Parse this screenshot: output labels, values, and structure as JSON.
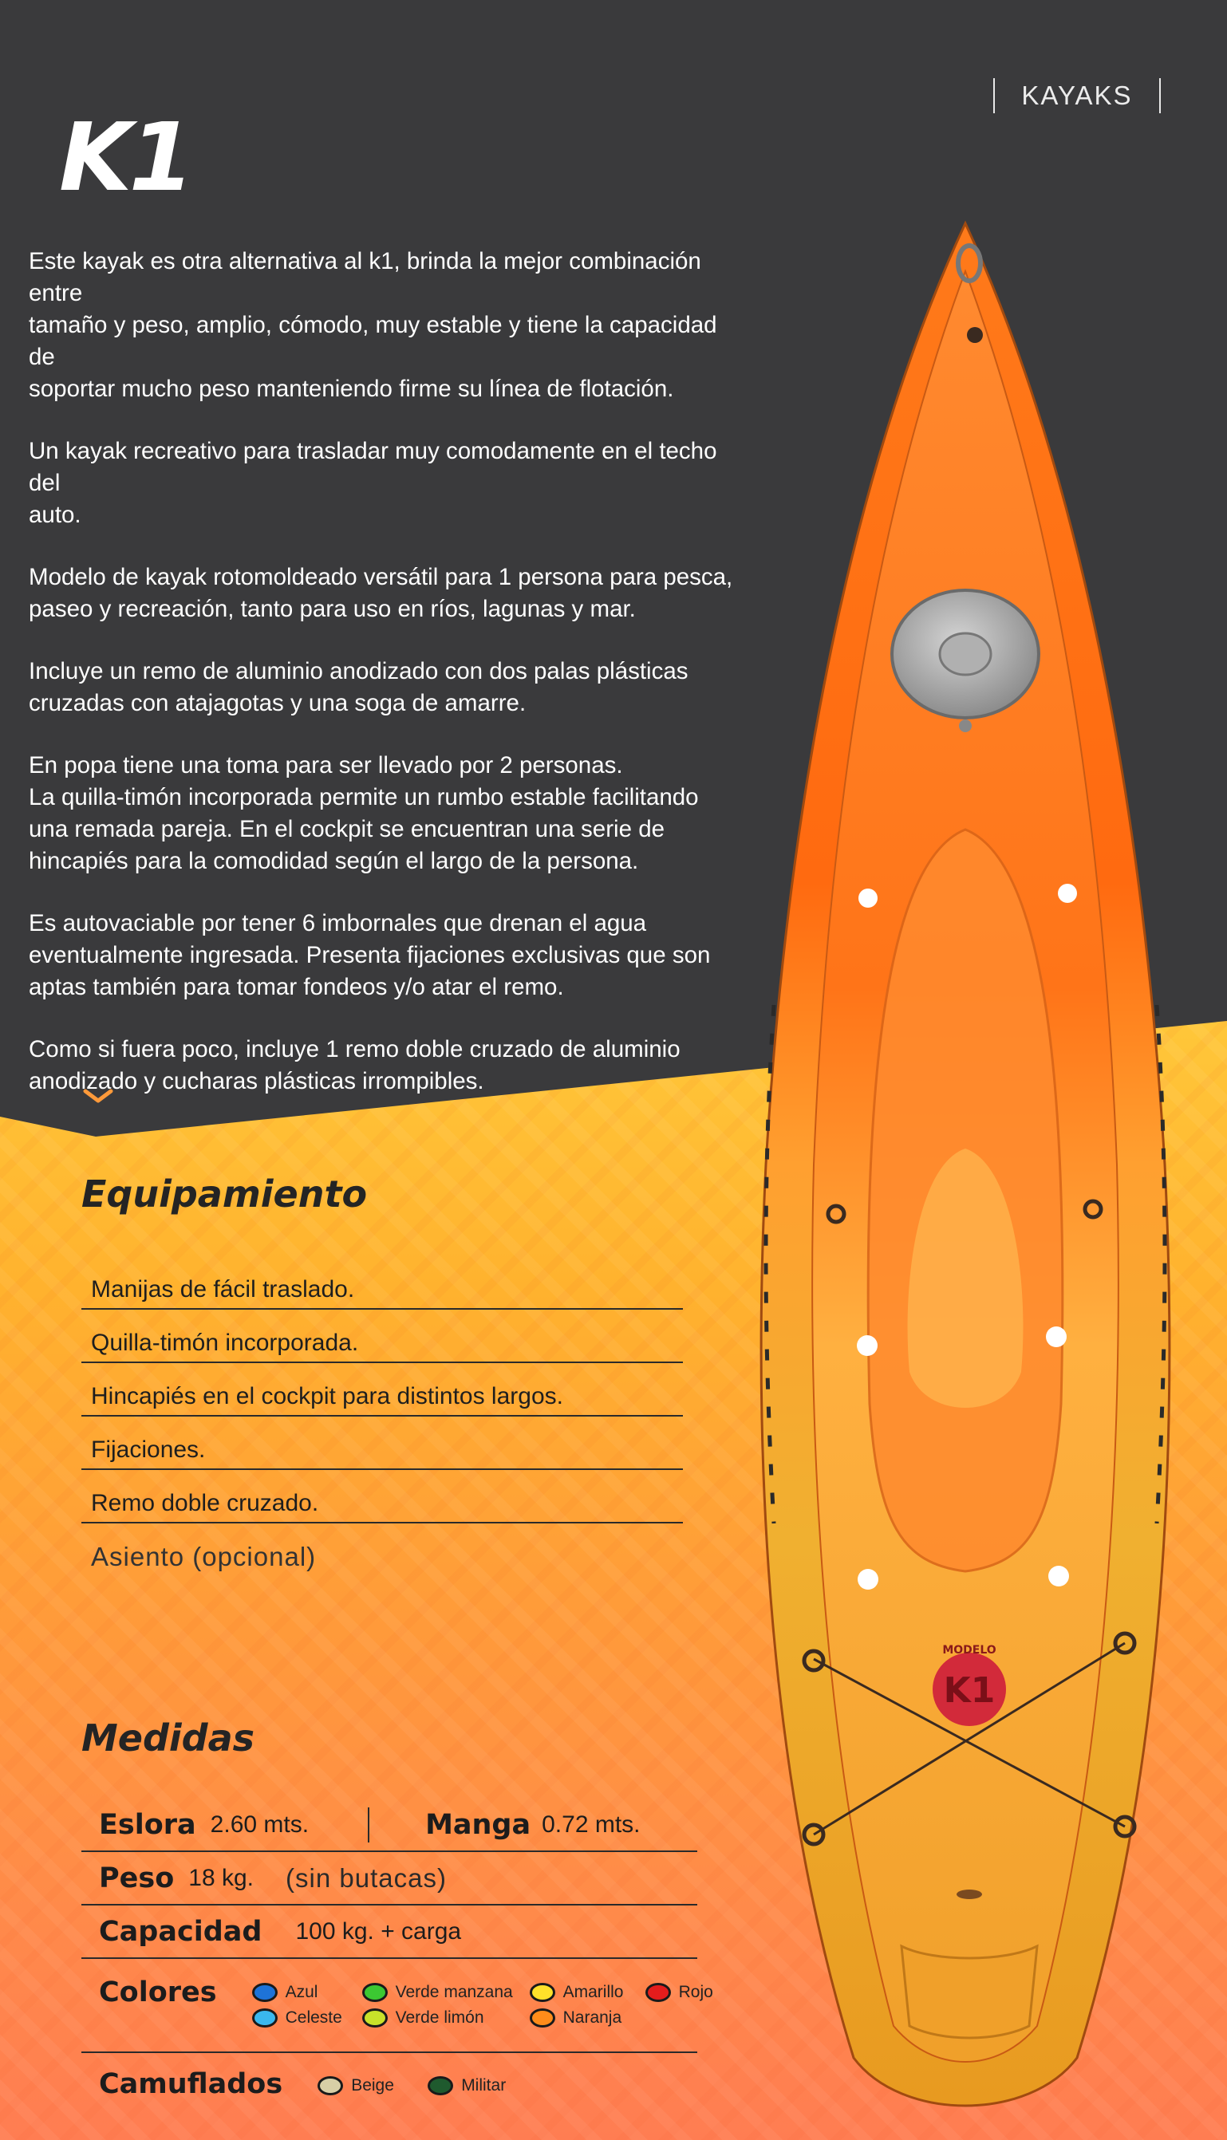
{
  "brand": {
    "category": "KAYAKS"
  },
  "model": {
    "title": "K1"
  },
  "description": {
    "p1": "Este kayak es otra alternativa al k1, brinda la mejor combinación entre\ntamaño y peso, amplio, cómodo, muy estable y tiene la capacidad de\nsoportar mucho peso manteniendo firme su línea de flotación.",
    "p2": "Un kayak recreativo para trasladar muy comodamente en el techo del\nauto.",
    "p3": "Modelo de kayak rotomoldeado versátil para 1 persona para pesca,\npaseo y recreación, tanto para uso en ríos, lagunas y mar.",
    "p4": "Incluye un remo de aluminio anodizado con dos palas plásticas\ncruzadas con atajagotas y una soga de amarre.",
    "p5": "En popa tiene una toma para ser llevado por 2 personas.\nLa quilla-timón incorporada permite un rumbo estable facilitando\nuna remada pareja. En el cockpit se encuentran una serie de\nhincapiés para la comodidad según el largo de la persona.",
    "p6": "Es autovaciable por tener 6 imbornales que drenan el agua\neventualmente ingresada. Presenta fijaciones exclusivas que son\naptas también para tomar fondeos y/o atar el remo.",
    "p7": "Como si fuera poco, incluye 1 remo doble cruzado de aluminio\nanodizado y cucharas plásticas irrompibles."
  },
  "equipment": {
    "title": "Equipamiento",
    "items": [
      "Manijas de fácil traslado.",
      "Quilla-timón incorporada.",
      "Hincapiés en el cockpit para distintos largos.",
      "Fijaciones.",
      "Remo doble cruzado.",
      "Asiento (opcional)"
    ]
  },
  "measures": {
    "title": "Medidas",
    "eslora_label": "Eslora",
    "eslora_value": "2.60 mts.",
    "manga_label": "Manga",
    "manga_value": "0.72 mts.",
    "peso_label": "Peso",
    "peso_value": "18 kg.",
    "peso_note": "(sin butacas)",
    "capacidad_label": "Capacidad",
    "capacidad_value": "100 kg. + carga",
    "colores_label": "Colores",
    "colors": [
      {
        "name": "Azul",
        "hex": "#1e73d8"
      },
      {
        "name": "Verde manzana",
        "hex": "#3cc832"
      },
      {
        "name": "Amarillo",
        "hex": "#ffe12a"
      },
      {
        "name": "Rojo",
        "hex": "#e41c1c"
      },
      {
        "name": "Celeste",
        "hex": "#3ab8ee"
      },
      {
        "name": "Verde limón",
        "hex": "#c8e22a"
      },
      {
        "name": "Naranja",
        "hex": "#ff8c1a"
      }
    ],
    "camuflados_label": "Camuflados",
    "camo": [
      {
        "name": "Beige",
        "hex": "#d8cfa6"
      },
      {
        "name": "Militar",
        "hex": "#1f5a2e"
      }
    ]
  },
  "kayak_logo": {
    "top": "MODELO",
    "main": "K1"
  },
  "colors_theme": {
    "dark_bg": "#3a3a3c",
    "accent_orange": "#ff8a3a",
    "accent_yellow": "#ffc83a"
  }
}
